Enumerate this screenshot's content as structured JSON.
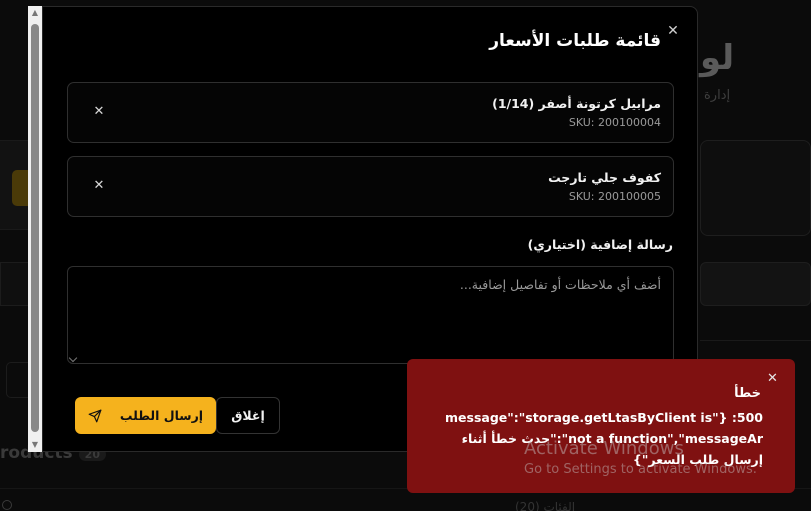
{
  "background": {
    "title": "لو",
    "subtitle": "إدارة",
    "products_label": "roducts",
    "products_count": "20",
    "bottom_text": "(20) الفئات"
  },
  "modal": {
    "title": "قائمة طلبات الأسعار",
    "items": [
      {
        "name": "مرابيل كرتونة أصفر (1/14)",
        "sku": "SKU: 200100004"
      },
      {
        "name": "كفوف جلي تارجت",
        "sku": "SKU: 200100005"
      }
    ],
    "message": {
      "label": "رسالة إضافية (اختياري)",
      "placeholder": "أضف أي ملاحظات أو تفاصيل إضافية...",
      "value": ""
    },
    "buttons": {
      "submit": "إرسال الطلب",
      "close": "إغلاق"
    }
  },
  "toast": {
    "title": "خطأ",
    "body": "500: {\"message\":\"storage.getLtasByClient is not a function\",\"messageAr\":\"حدث خطأ أثناء إرسال طلب السعر\"}"
  },
  "watermark": {
    "title": "Activate Windows",
    "subtitle": "Go to Settings to activate Windows."
  },
  "colors": {
    "accent": "#f5b21d",
    "error": "#7f1111",
    "modal_bg": "#000000"
  }
}
